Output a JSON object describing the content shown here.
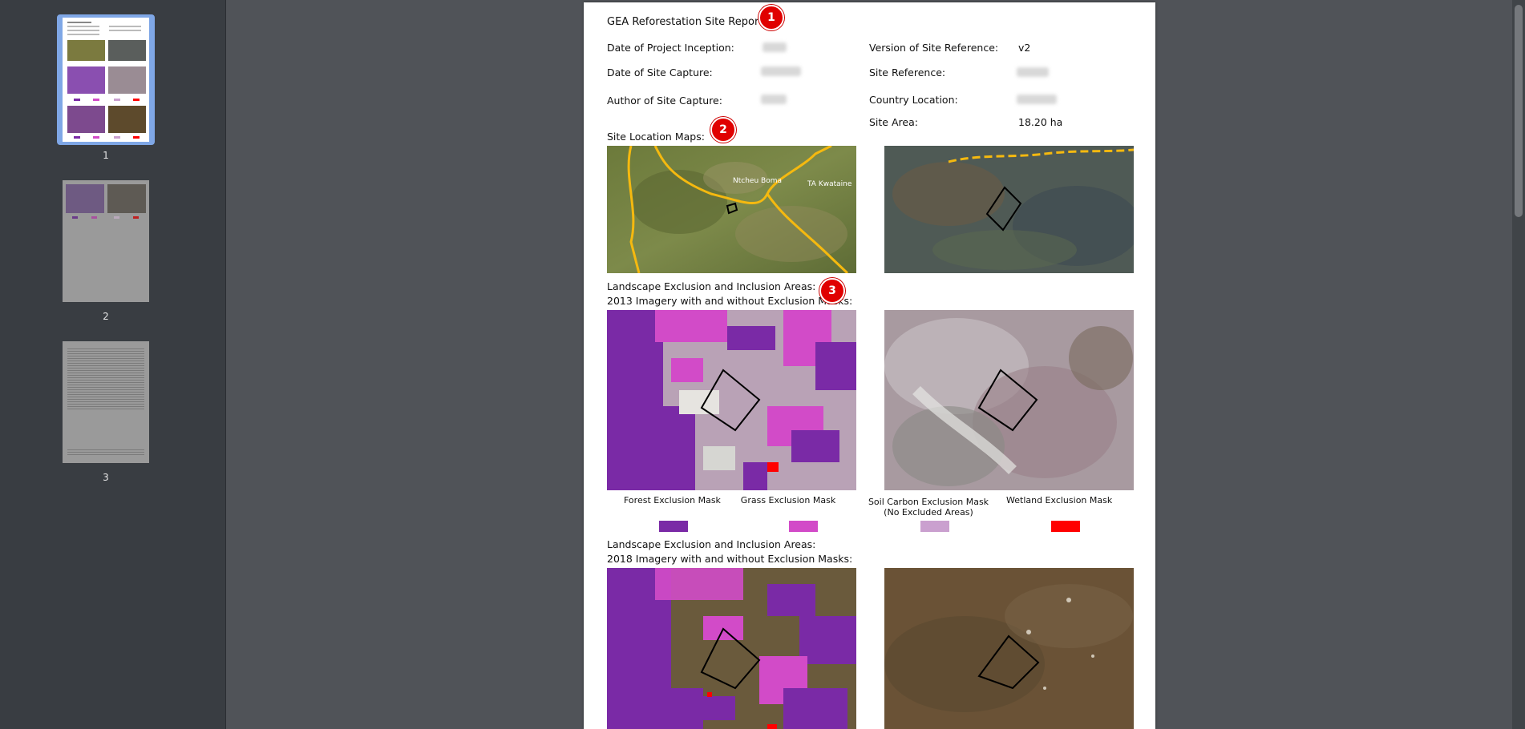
{
  "sidebar": {
    "pages": [
      {
        "num": "1"
      },
      {
        "num": "2"
      },
      {
        "num": "3"
      }
    ]
  },
  "report": {
    "title": "GEA Reforestation Site Report",
    "fields_left": [
      {
        "label": "Date of Project Inception:"
      },
      {
        "label": "Date of Site Capture:"
      },
      {
        "label": "Author of Site Capture:"
      }
    ],
    "fields_right": [
      {
        "label": "Version of Site Reference:",
        "value": "v2"
      },
      {
        "label": "Site Reference:",
        "value": ""
      },
      {
        "label": "Country Location:",
        "value": ""
      },
      {
        "label": "Site Area:",
        "value": "18.20 ha"
      }
    ],
    "location_heading": "Site Location Maps:",
    "map_labels": [
      "Ntcheu Boma",
      "TA Kwataine"
    ],
    "section_2013": {
      "line1": "Landscape Exclusion and Inclusion Areas:",
      "line2": "2013 Imagery with and without Exclusion Masks:"
    },
    "section_2018": {
      "line1": "Landscape Exclusion and Inclusion Areas:",
      "line2": "2018 Imagery with and without Exclusion Masks:"
    },
    "legend": [
      {
        "label": "Forest Exclusion Mask",
        "color": "#7a2aa6"
      },
      {
        "label": "Grass Exclusion Mask",
        "color": "#d24bc8"
      },
      {
        "label": "Soil Carbon Exclusion Mask",
        "label2": "(No Excluded Areas)",
        "color": "#caa0cf"
      },
      {
        "label": "Wetland Exclusion Mask",
        "color": "#ff0000"
      }
    ],
    "badges": [
      "1",
      "2",
      "3"
    ]
  }
}
